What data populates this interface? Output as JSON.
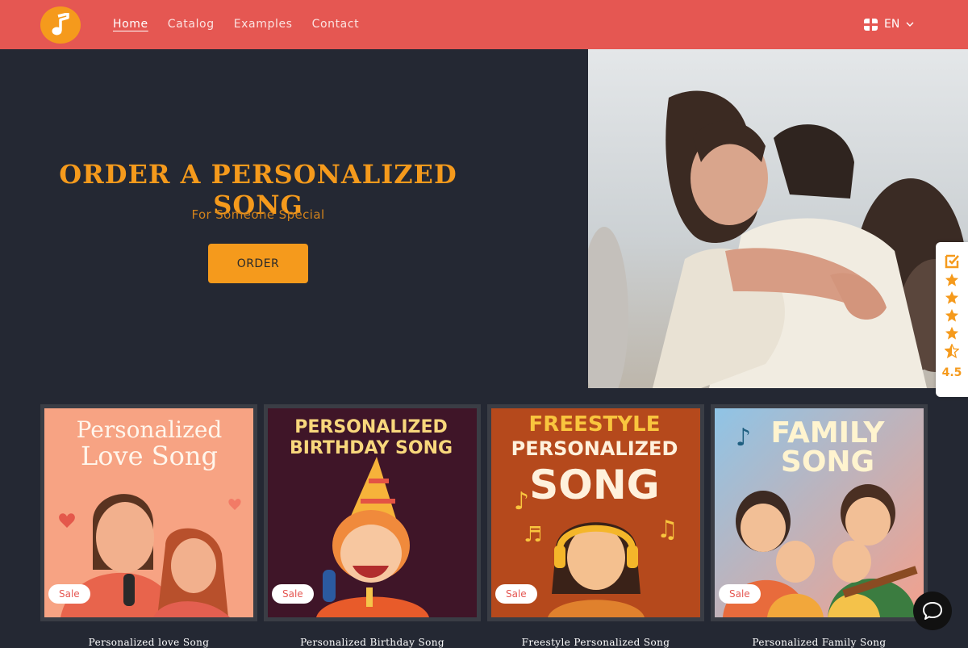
{
  "nav": {
    "items": [
      {
        "label": "Home",
        "active": true
      },
      {
        "label": "Catalog",
        "active": false
      },
      {
        "label": "Examples",
        "active": false
      },
      {
        "label": "Contact",
        "active": false
      }
    ],
    "language": "EN"
  },
  "hero": {
    "title": "ORDER A PERSONALIZED SONG",
    "subtitle": "For Someone Special",
    "cta": "ORDER"
  },
  "rating": {
    "score": "4.5",
    "value": 4.5,
    "max": 5
  },
  "products": [
    {
      "title": "Personalized love Song",
      "badge": "Sale",
      "art_lines": [
        "Personalized",
        "Love Song"
      ]
    },
    {
      "title": "Personalized Birthday Song",
      "badge": "Sale",
      "art_lines": [
        "PERSONALIZED",
        "BIRTHDAY SONG"
      ]
    },
    {
      "title": "Freestyle Personalized Song",
      "badge": "Sale",
      "art_lines": [
        "FREESTYLE",
        "PERSONALIZED",
        "SONG"
      ]
    },
    {
      "title": "Personalized Family Song",
      "badge": "Sale",
      "art_lines": [
        "FAMILY",
        "SONG"
      ]
    }
  ],
  "colors": {
    "header": "#e55752",
    "accent": "#f59a1c",
    "background": "#242833"
  },
  "icons": [
    "music-note-icon",
    "chevron-down-icon",
    "check-badge-icon",
    "star-icon",
    "star-half-icon",
    "chat-bubble-icon"
  ]
}
